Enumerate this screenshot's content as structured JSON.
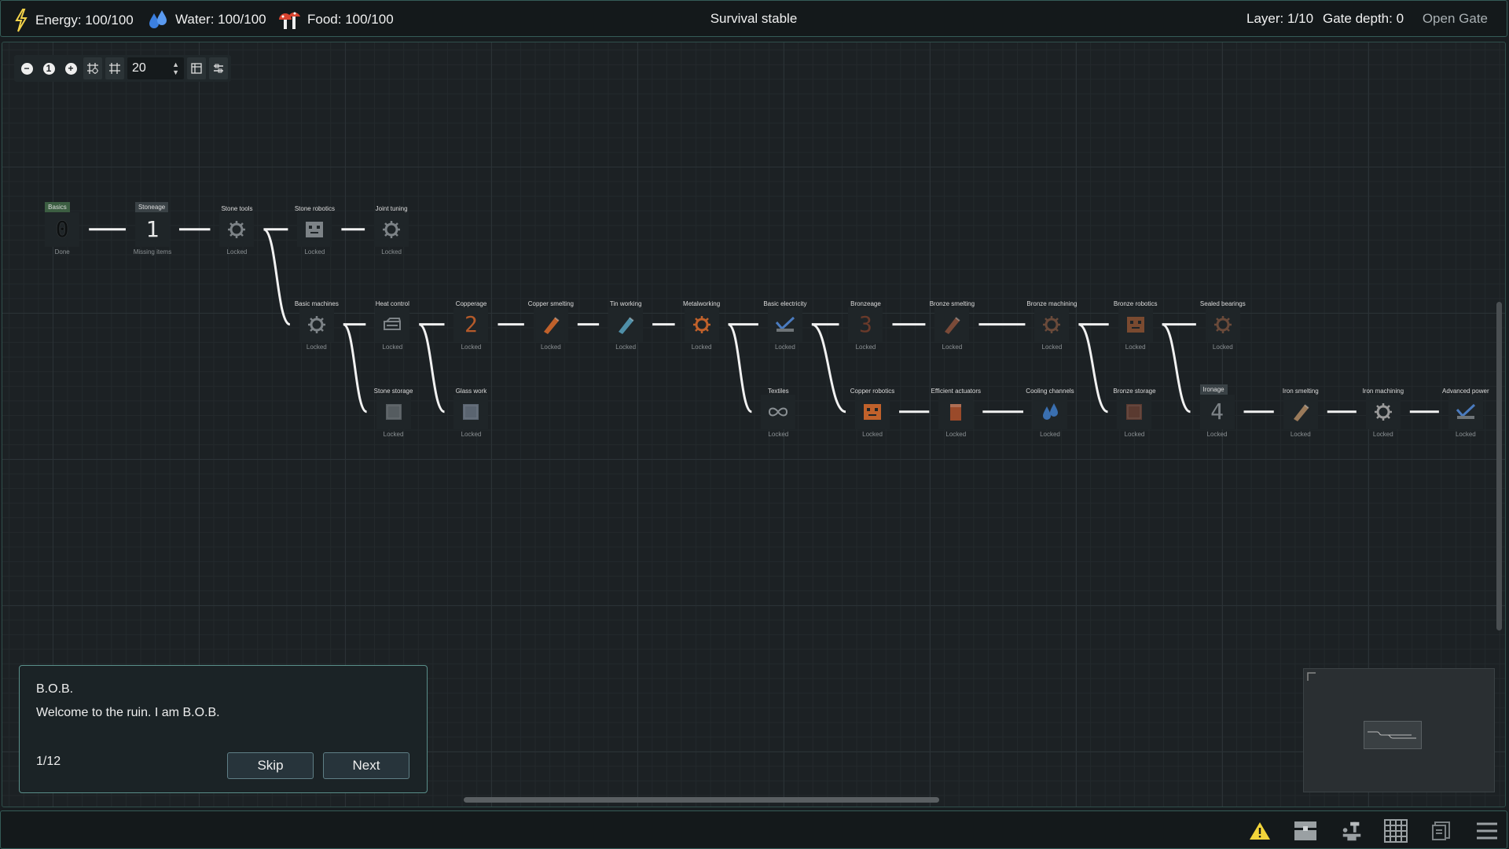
{
  "hud": {
    "energy": "Energy: 100/100",
    "water": "Water: 100/100",
    "food": "Food: 100/100",
    "status": "Survival stable",
    "layer": "Layer: 1/10",
    "gate_depth": "Gate depth: 0",
    "open_gate": "Open Gate"
  },
  "toolbar": {
    "zoom_out": "−",
    "zoom_reset": "1",
    "zoom_in": "+",
    "grid_value": "20"
  },
  "tech_nodes": [
    {
      "id": "basics",
      "label": "Basics",
      "status": "Done",
      "glyph": "0",
      "tag": "green"
    },
    {
      "id": "stoneage",
      "label": "Stoneage",
      "status": "Missing items",
      "glyph": "1",
      "tag": "gray"
    },
    {
      "id": "stone-tools",
      "label": "Stone tools",
      "status": "Locked",
      "icon": "gear"
    },
    {
      "id": "stone-robotics",
      "label": "Stone robotics",
      "status": "Locked",
      "icon": "robot"
    },
    {
      "id": "joint-tuning",
      "label": "Joint tuning",
      "status": "Locked",
      "icon": "gear"
    },
    {
      "id": "basic-machines",
      "label": "Basic machines",
      "status": "Locked",
      "icon": "gear"
    },
    {
      "id": "heat-control",
      "label": "Heat control",
      "status": "Locked",
      "icon": "furnace"
    },
    {
      "id": "copperage",
      "label": "Copperage",
      "status": "Locked",
      "glyph": "2",
      "color": "#b55a2a"
    },
    {
      "id": "copper-smelting",
      "label": "Copper smelting",
      "status": "Locked",
      "icon": "ingot",
      "color": "#c0612b"
    },
    {
      "id": "tin-working",
      "label": "Tin working",
      "status": "Locked",
      "icon": "ingot",
      "color": "#4f8fa8"
    },
    {
      "id": "metalworking",
      "label": "Metalworking",
      "status": "Locked",
      "icon": "gear",
      "color": "#c0612b"
    },
    {
      "id": "basic-electricity",
      "label": "Basic electricity",
      "status": "Locked",
      "icon": "spark",
      "color": "#4a7bbf"
    },
    {
      "id": "bronzeage",
      "label": "Bronzeage",
      "status": "Locked",
      "glyph": "3",
      "color": "#6a3a2a"
    },
    {
      "id": "bronze-smelting",
      "label": "Bronze smelting",
      "status": "Locked",
      "icon": "ingot",
      "color": "#7a4a38"
    },
    {
      "id": "bronze-machining",
      "label": "Bronze machining",
      "status": "Locked",
      "icon": "gear",
      "color": "#6a4a3a"
    },
    {
      "id": "bronze-robotics",
      "label": "Bronze robotics",
      "status": "Locked",
      "icon": "robot",
      "color": "#7a4a30"
    },
    {
      "id": "sealed-bearings",
      "label": "Sealed bearings",
      "status": "Locked",
      "icon": "gear",
      "color": "#6a4a3a"
    },
    {
      "id": "stone-storage",
      "label": "Stone storage",
      "status": "Locked",
      "icon": "box",
      "color": "#555c60"
    },
    {
      "id": "glass-work",
      "label": "Glass work",
      "status": "Locked",
      "icon": "box",
      "color": "#5a6470"
    },
    {
      "id": "textiles",
      "label": "Textiles",
      "status": "Locked",
      "icon": "loop"
    },
    {
      "id": "copper-robotics",
      "label": "Copper robotics",
      "status": "Locked",
      "icon": "robot",
      "color": "#c0612b"
    },
    {
      "id": "efficient-actuators",
      "label": "Efficient actuators",
      "status": "Locked",
      "icon": "cylinder",
      "color": "#9a4a2a"
    },
    {
      "id": "cooling-channels",
      "label": "Cooling channels",
      "status": "Locked",
      "icon": "drops",
      "color": "#3a6fb0"
    },
    {
      "id": "bronze-storage",
      "label": "Bronze storage",
      "status": "Locked",
      "icon": "box",
      "color": "#5a3a30"
    },
    {
      "id": "ironage",
      "label": "Ironage",
      "status": "Locked",
      "glyph": "4",
      "tag": "gray"
    },
    {
      "id": "iron-smelting",
      "label": "Iron smelting",
      "status": "Locked",
      "icon": "ingot",
      "color": "#9a7a5a"
    },
    {
      "id": "iron-machining",
      "label": "Iron machining",
      "status": "Locked",
      "icon": "gear",
      "color": "#9a9a9a"
    },
    {
      "id": "advanced-power",
      "label": "Advanced power",
      "status": "Locked",
      "icon": "spark",
      "color": "#4a7bbf"
    }
  ],
  "dialog": {
    "speaker": "B.O.B.",
    "message": "Welcome to the ruin. I am B.O.B.",
    "page": "1/12",
    "skip": "Skip",
    "next": "Next"
  },
  "colors": {
    "accent": "#5a8f8a",
    "energy": "#f2d24a",
    "water": "#3b7fe0",
    "food": "#d8432f",
    "warning": "#f2d43a"
  }
}
